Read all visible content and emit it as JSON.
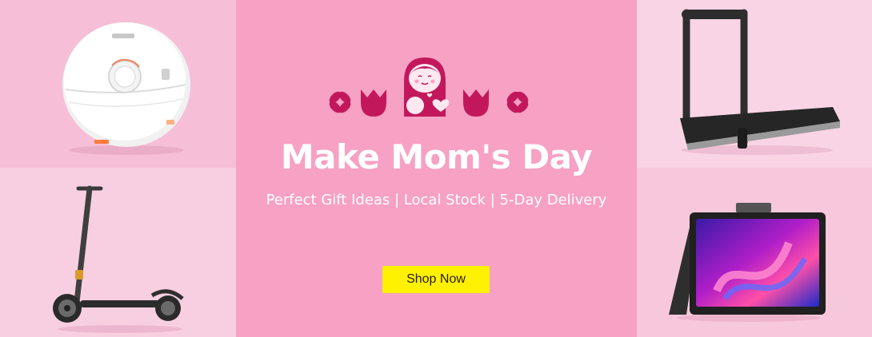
{
  "banner": {
    "title": "Make Mom's Day",
    "subtitle": "Perfect Gift Ideas | Local Stock | 5-Day Delivery",
    "cta_label": "Shop Now"
  },
  "icons": {
    "logo": "mother-child-heart-icon",
    "left_flower": "x-flower-icon",
    "left_tulip": "tulip-icon",
    "right_tulip": "tulip-icon",
    "right_flower": "x-flower-icon"
  },
  "products": {
    "top_left": "robot-vacuum-image",
    "bottom_left": "electric-scooter-image",
    "top_right": "folding-treadmill-image",
    "bottom_right": "mini-laptop-image"
  },
  "colors": {
    "center_bg": "#f7a1c4",
    "accent": "#c2185b",
    "cta_bg": "#fff100"
  }
}
